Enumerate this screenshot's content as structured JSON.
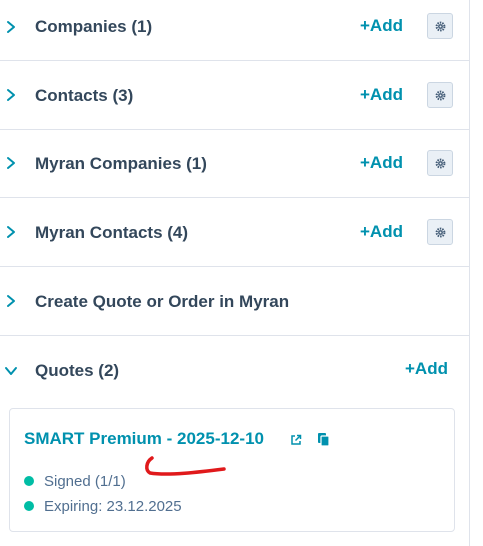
{
  "sections": [
    {
      "title": "Companies (1)",
      "add_label": "+Add",
      "has_settings": true,
      "expanded": false
    },
    {
      "title": "Contacts (3)",
      "add_label": "+Add",
      "has_settings": true,
      "expanded": false
    },
    {
      "title": "Myran Companies (1)",
      "add_label": "+Add",
      "has_settings": true,
      "expanded": false
    },
    {
      "title": "Myran Contacts (4)",
      "add_label": "+Add",
      "has_settings": true,
      "expanded": false
    },
    {
      "title": "Create Quote or Order in Myran",
      "add_label": "",
      "has_settings": false,
      "expanded": false
    }
  ],
  "quotes": {
    "title": "Quotes (2)",
    "add_label": "+Add",
    "expanded": true,
    "card": {
      "name": "SMART Premium - 2025-12-10",
      "status": "Signed (1/1)",
      "expiry": "Expiring: 23.12.2025"
    }
  },
  "colors": {
    "accent": "#0091ae",
    "text": "#33475b",
    "status_dot": "#00bda5",
    "annotation": "#e0191b"
  },
  "icons": {
    "collapsed": "chevron-right-icon",
    "expanded": "chevron-down-icon",
    "settings": "gear-icon",
    "external": "external-link-icon",
    "copy": "copy-icon"
  }
}
